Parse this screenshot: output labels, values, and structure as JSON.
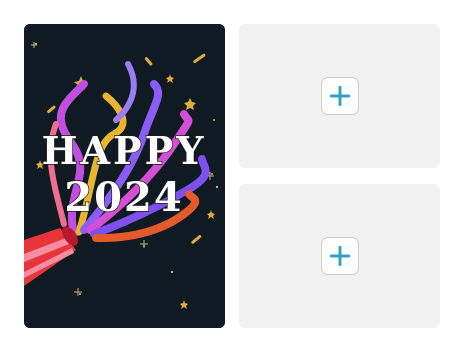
{
  "card": {
    "line1": "HAPPY",
    "line2": "2024",
    "background_color": "#0f1a22"
  },
  "slots": [
    {
      "icon": "plus-icon",
      "color": "#2aa6b8"
    },
    {
      "icon": "plus-icon",
      "color": "#2aa6b8"
    }
  ]
}
